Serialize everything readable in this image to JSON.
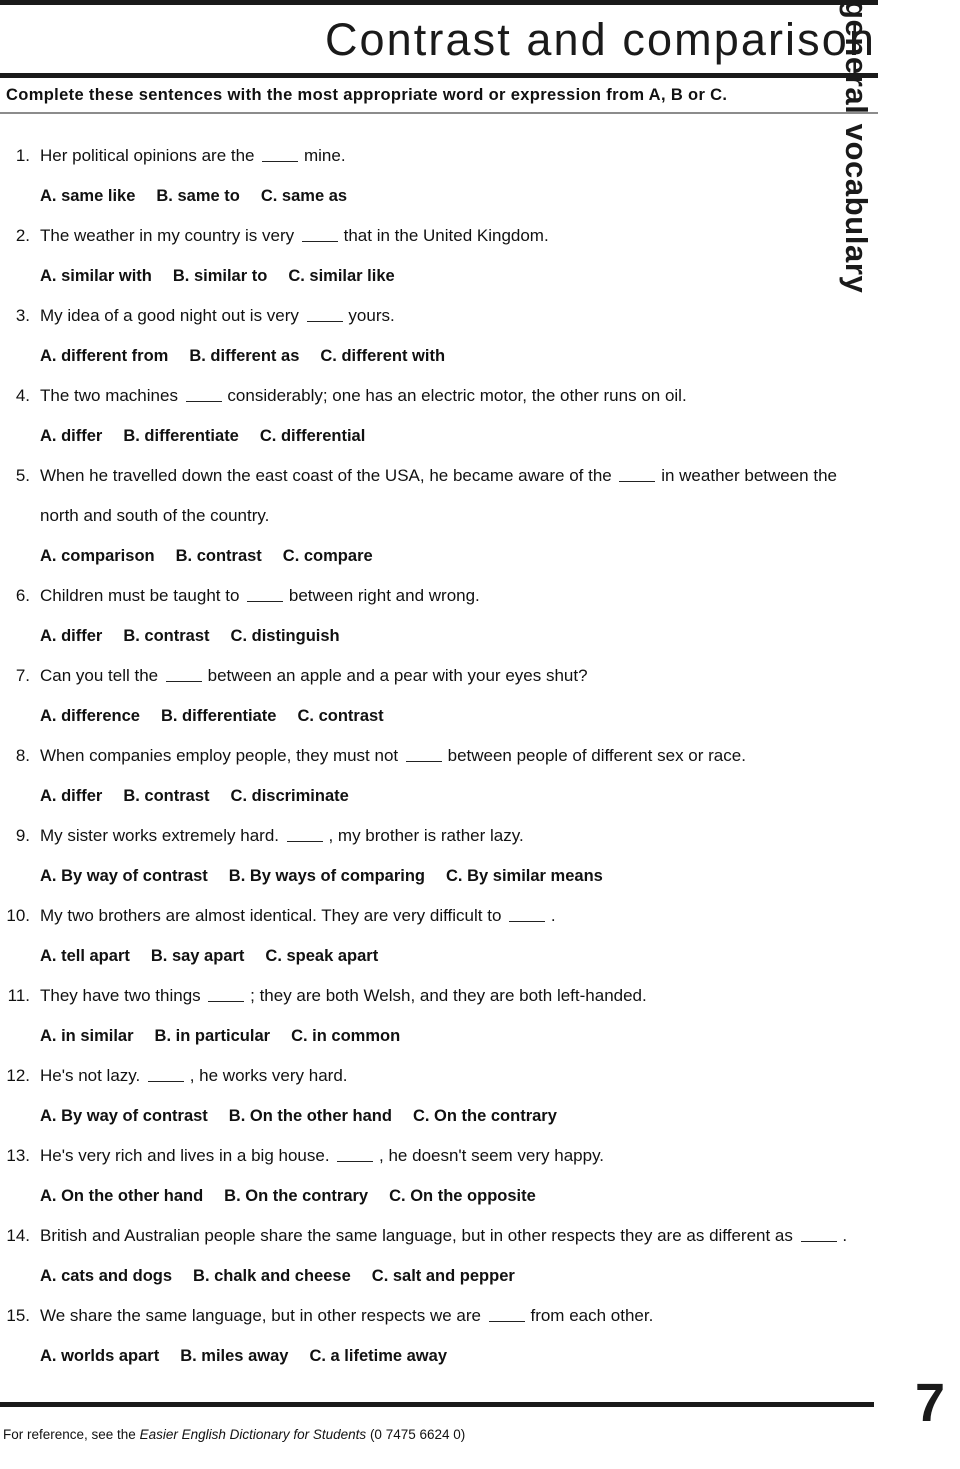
{
  "sidebar": {
    "label": "general vocabulary"
  },
  "header": {
    "title": "Contrast and comparison",
    "instruction": "Complete these sentences with the most appropriate word or expression from A, B or C."
  },
  "questions": [
    {
      "number": "1.",
      "text_before": "Her political opinions are the",
      "text_after": "mine.",
      "justify": false,
      "options": [
        "A. same like",
        "B. same to",
        "C. same as"
      ]
    },
    {
      "number": "2.",
      "text_before": "The weather in my country is very",
      "text_after": "that in the United Kingdom.",
      "justify": false,
      "options": [
        "A. similar with",
        "B. similar to",
        "C. similar like"
      ]
    },
    {
      "number": "3.",
      "text_before": "My idea of a good night out is very",
      "text_after": "yours.",
      "justify": false,
      "options": [
        "A. different from",
        "B. different as",
        "C. different with"
      ]
    },
    {
      "number": "4.",
      "text_before": "The two machines",
      "text_after": "considerably; one has an electric motor, the other runs on oil.",
      "justify": false,
      "options": [
        "A. differ",
        "B. differentiate",
        "C. differential"
      ]
    },
    {
      "number": "5.",
      "text_before": "When he travelled down the east coast of the USA, he became aware of the",
      "text_after": "in weather between the north and south of the country.",
      "justify": false,
      "options": [
        "A. comparison",
        "B. contrast",
        "C. compare"
      ]
    },
    {
      "number": "6.",
      "text_before": "Children must be taught to",
      "text_after": "between right and wrong.",
      "justify": false,
      "options": [
        "A. differ",
        "B. contrast",
        "C. distinguish"
      ]
    },
    {
      "number": "7.",
      "text_before": "Can you tell the",
      "text_after": "between an apple and a pear with your eyes shut?",
      "justify": false,
      "options": [
        "A. difference",
        "B. differentiate",
        "C. contrast"
      ]
    },
    {
      "number": "8.",
      "text_before": "When companies employ people, they must not",
      "text_after": "between people of different sex or race.",
      "justify": false,
      "options": [
        "A. differ",
        "B. contrast",
        "C. discriminate"
      ]
    },
    {
      "number": "9.",
      "text_before": "My sister works extremely hard.",
      "text_after": ", my brother is rather lazy.",
      "justify": false,
      "options": [
        "A. By way of contrast",
        "B. By ways of comparing",
        "C. By similar means"
      ]
    },
    {
      "number": "10.",
      "text_before": "My two brothers are almost identical. They are very difficult to",
      "text_after": ".",
      "justify": false,
      "options": [
        "A. tell apart",
        "B. say apart",
        "C. speak apart"
      ]
    },
    {
      "number": "11.",
      "text_before": "They have two things",
      "text_after": "; they are both Welsh, and they are both left-handed.",
      "justify": false,
      "options": [
        "A. in similar",
        "B. in particular",
        "C. in common"
      ]
    },
    {
      "number": "12.",
      "text_before": "He's not lazy.",
      "text_after": ", he works very hard.",
      "justify": false,
      "options": [
        "A. By way of contrast",
        "B. On the other hand",
        "C. On the contrary"
      ]
    },
    {
      "number": "13.",
      "text_before": "He's very rich and lives in a big house.",
      "text_after": ", he doesn't seem very happy.",
      "justify": false,
      "options": [
        "A. On the other hand",
        "B. On the contrary",
        "C. On the opposite"
      ]
    },
    {
      "number": "14.",
      "text_before": "British and Australian people share the same language, but in other respects they are as different as",
      "text_after": ".",
      "justify": true,
      "options": [
        "A. cats and dogs",
        "B. chalk and cheese",
        "C. salt and pepper"
      ]
    },
    {
      "number": "15.",
      "text_before": "We share the same language, but in other respects we are",
      "text_after": "from each other.",
      "justify": false,
      "options": [
        "A. worlds apart",
        "B. miles away",
        "C. a lifetime away"
      ]
    }
  ],
  "footer": {
    "note_before": "For reference, see the ",
    "note_italic": "Easier English Dictionary for Students",
    "note_after": " (0 7475 6624 0)",
    "page_number": "7"
  }
}
